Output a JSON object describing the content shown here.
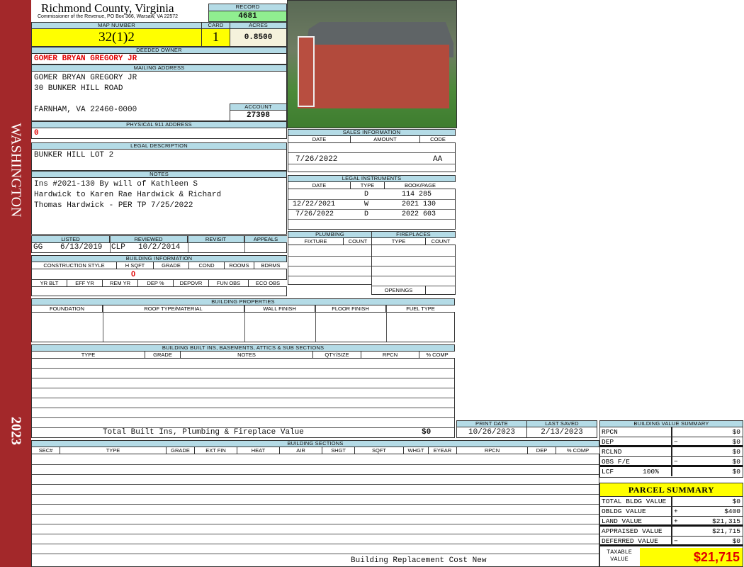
{
  "sidebar": {
    "district": "WASHINGTON",
    "year": "2023"
  },
  "header": {
    "title": "Richmond County, Virginia",
    "subtitle": "Commissioner of the Revenue, PO Box 366, Warsaw, VA 22572",
    "record_label": "RECORD",
    "record": "4681"
  },
  "parcel": {
    "map_label": "MAP NUMBER",
    "map": "32(1)2",
    "card_label": "CARD",
    "card": "1",
    "acres_label": "ACRES",
    "acres": "0.8500"
  },
  "owner": {
    "label": "DEEDED OWNER",
    "name": "GOMER BRYAN GREGORY JR",
    "mail_label": "MAILING ADDRESS",
    "mail": [
      "GOMER BRYAN GREGORY JR",
      "30 BUNKER HILL ROAD",
      "",
      "FARNHAM, VA 22460-0000"
    ],
    "account_label": "ACCOUNT",
    "account": "27398",
    "phys_label": "PHYSICAL 911 ADDRESS",
    "phys": "0"
  },
  "legal": {
    "label": "LEGAL DESCRIPTION",
    "text": "BUNKER HILL LOT 2"
  },
  "notes": {
    "label": "NOTES",
    "lines": [
      "Ins #2021-130 By will of Kathleen S",
      "Hardwick to Karen Rae Hardwick & Richard",
      "Thomas Hardwick - PER TP 7/25/2022"
    ]
  },
  "sales": {
    "label": "SALES INFORMATION",
    "cols": [
      "DATE",
      "AMOUNT",
      "CODE"
    ],
    "rows": [
      {
        "date": "7/26/2022",
        "amount": "",
        "code": "AA"
      }
    ]
  },
  "instruments": {
    "label": "LEGAL INSTRUMENTS",
    "cols": [
      "DATE",
      "TYPE",
      "BOOK/PAGE"
    ],
    "rows": [
      {
        "date": "",
        "type": "D",
        "bp": "114 285"
      },
      {
        "date": "12/22/2021",
        "type": "W",
        "bp": "2021 130"
      },
      {
        "date": "7/26/2022",
        "type": "D",
        "bp": "2022 603"
      }
    ]
  },
  "review": {
    "cols": [
      "LISTED",
      "REVIEWED",
      "REVISIT",
      "APPEALS"
    ],
    "listed_by": "GG",
    "listed": "6/13/2019",
    "reviewed_by": "CLP",
    "reviewed": "10/2/2014"
  },
  "plumbing": {
    "label": "PLUMBING",
    "cols": [
      "FIXTURE",
      "COUNT"
    ]
  },
  "fireplaces": {
    "label": "FIREPLACES",
    "cols": [
      "TYPE",
      "COUNT"
    ],
    "openings": "OPENINGS"
  },
  "building_info": {
    "label": "BUILDING INFORMATION",
    "cols1": [
      "CONSTRUCTION STYLE",
      "H SQFT",
      "GRADE",
      "COND",
      "ROOMS",
      "BDRMS"
    ],
    "hsqft": "0",
    "cols2": [
      "YR BLT",
      "EFF YR",
      "REM YR",
      "DEP %",
      "DEPOVR",
      "FUN OBS",
      "ECO OBS"
    ]
  },
  "properties": {
    "label": "BUILDING PROPERTIES",
    "cols": [
      "FOUNDATION",
      "ROOF TYPE/MATERIAL",
      "WALL FINISH",
      "FLOOR FINISH",
      "FUEL TYPE"
    ]
  },
  "builtins": {
    "label": "BUILDING BUILT INS, BASEMENTS, ATTICS & SUB SECTIONS",
    "cols": [
      "TYPE",
      "GRADE",
      "NOTES",
      "QTY/SIZE",
      "RPCN",
      "% COMP"
    ],
    "total_label": "Total Built Ins, Plumbing & Fireplace Value",
    "total": "$0"
  },
  "dates": {
    "print_label": "PRINT DATE",
    "print": "10/26/2023",
    "saved_label": "LAST SAVED",
    "saved": "2/13/2023"
  },
  "sections": {
    "label": "BUILDING SECTIONS",
    "cols": [
      "SEC#",
      "TYPE",
      "GRADE",
      "EXT FIN",
      "HEAT",
      "AIR",
      "SHGT",
      "SQFT",
      "WHGT",
      "EYEAR",
      "RPCN",
      "DEP",
      "% COMP"
    ],
    "footer": "Building Replacement Cost New"
  },
  "value_summary": {
    "label": "BUILDING VALUE SUMMARY",
    "rows": [
      {
        "l": "RPCN",
        "op": "",
        "v": "$0"
      },
      {
        "l": "DEP",
        "op": "−",
        "v": "$0"
      },
      {
        "l": "RCLND",
        "op": "",
        "v": "$0"
      },
      {
        "l": "OBS F/E",
        "op": "−",
        "v": "$0"
      },
      {
        "l": "LCF",
        "pct": "100%",
        "op": "",
        "v": "$0"
      }
    ]
  },
  "parcel_summary": {
    "label": "PARCEL SUMMARY",
    "rows": [
      {
        "l": "TOTAL BLDG VALUE",
        "op": "",
        "v": "$0"
      },
      {
        "l": "OBLDG VALUE",
        "op": "+",
        "v": "$400"
      },
      {
        "l": "LAND VALUE",
        "op": "+",
        "v": "$21,315"
      },
      {
        "l": "APPRAISED VALUE",
        "op": "",
        "v": "$21,715"
      },
      {
        "l": "DEFERRED VALUE",
        "op": "−",
        "v": "$0"
      }
    ],
    "taxable_label": "TAXABLE VALUE",
    "taxable": "$21,715"
  },
  "colors": {
    "header": "#b4dbe6",
    "highlight": "#ffff00",
    "record": "#90ee90",
    "sidebar": "#a3282a",
    "red": "#e00000"
  }
}
